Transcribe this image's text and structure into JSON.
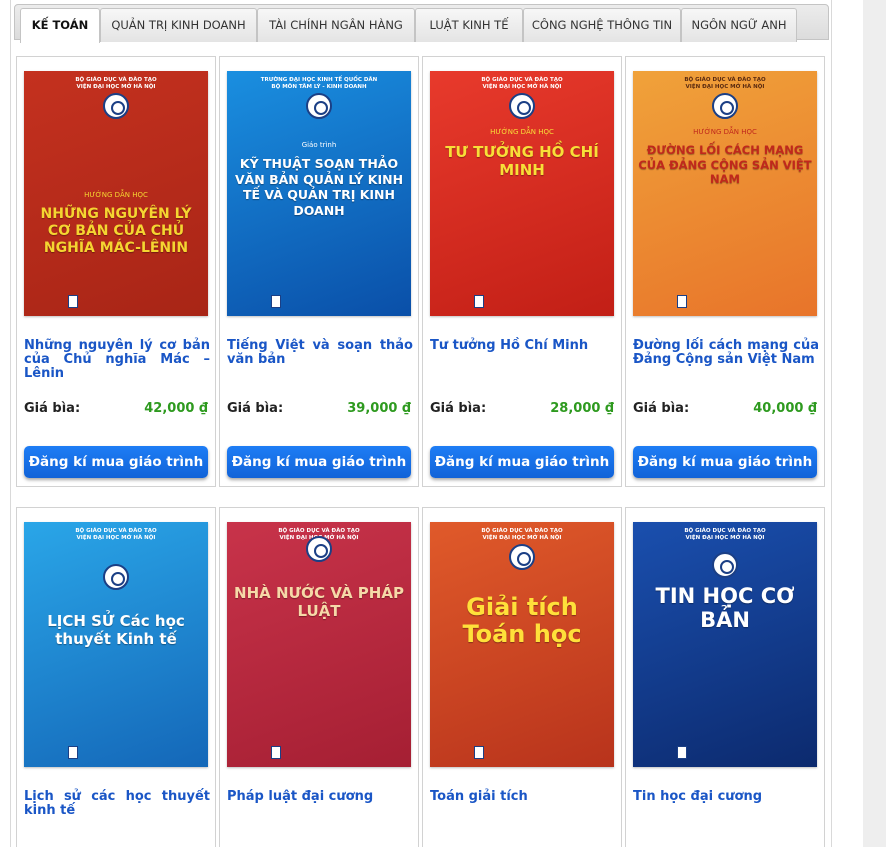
{
  "tabs": [
    {
      "label": "KẾ TOÁN",
      "active": true
    },
    {
      "label": "QUẢN TRỊ KINH DOANH",
      "active": false
    },
    {
      "label": "TÀI CHÍNH NGÂN HÀNG",
      "active": false
    },
    {
      "label": "LUẬT KINH TẾ",
      "active": false
    },
    {
      "label": "CÔNG NGHỆ THÔNG TIN",
      "active": false
    },
    {
      "label": "NGÔN NGỮ ANH",
      "active": false
    }
  ],
  "price_label": "Giá bìa:",
  "buy_label": "Đăng kí mua giáo trình",
  "books": [
    {
      "title": "Những nguyên lý cơ bản của Chủ nghĩa Mác – Lênin",
      "price": "42,000 ₫",
      "cover": {
        "publisher_top": "BỘ GIÁO DỤC VÀ ĐÀO TẠO\nVIỆN ĐẠI HỌC MỞ HÀ NỘI",
        "kicker": "HƯỚNG DẪN HỌC",
        "title": "NHỮNG NGUYÊN LÝ CƠ BẢN CỦA CHỦ NGHĨA MÁC-LÊNIN",
        "colors": [
          "#c4311f",
          "#a82516"
        ],
        "text_color": "#f5d531"
      }
    },
    {
      "title": "Tiếng Việt và soạn thảo văn bản",
      "price": "39,000 ₫",
      "cover": {
        "publisher_top": "TRƯỜNG ĐẠI HỌC KINH TẾ QUỐC DÂN\nBỘ MÔN TÂM LÝ - KINH DOANH",
        "kicker": "Giáo trình",
        "title": "KỸ THUẬT SOẠN THẢO VĂN BẢN QUẢN LÝ KINH TẾ VÀ QUẢN TRỊ KINH DOANH",
        "colors": [
          "#1a8fe0",
          "#0a4fa8"
        ],
        "text_color": "#ffffff"
      }
    },
    {
      "title": "Tư tưởng Hồ Chí Minh",
      "price": "28,000 ₫",
      "cover": {
        "publisher_top": "BỘ GIÁO DỤC VÀ ĐÀO TẠO\nVIỆN ĐẠI HỌC MỞ HÀ NỘI",
        "kicker": "HƯỚNG DẪN HỌC",
        "title": "TƯ TƯỞNG HỒ CHÍ MINH",
        "colors": [
          "#e83a2c",
          "#c21f16"
        ],
        "text_color": "#f8df38"
      }
    },
    {
      "title": "Đường lối cách mạng của Đảng Cộng sản Việt Nam",
      "price": "40,000 ₫",
      "cover": {
        "publisher_top": "BỘ GIÁO DỤC VÀ ĐÀO TẠO\nVIỆN ĐẠI HỌC MỞ HÀ NỘI",
        "kicker": "HƯỚNG DẪN HỌC",
        "title": "ĐƯỜNG LỐI CÁCH MẠNG CỦA ĐẢNG CỘNG SẢN VIỆT NAM",
        "colors": [
          "#f0a23a",
          "#e8742a"
        ],
        "text_color": "#c0281c"
      }
    },
    {
      "title": "Lịch sử các học thuyết kinh tế",
      "price": "",
      "cover": {
        "publisher_top": "BỘ GIÁO DỤC VÀ ĐÀO TẠO\nVIỆN ĐẠI HỌC MỞ HÀ NỘI",
        "kicker": "",
        "title": "LỊCH SỬ Các học thuyết Kinh tế",
        "colors": [
          "#2aa6e8",
          "#1467b8"
        ],
        "text_color": "#ffffff"
      }
    },
    {
      "title": "Pháp luật đại cương",
      "price": "",
      "cover": {
        "publisher_top": "BỘ GIÁO DỤC VÀ ĐÀO TẠO\nVIỆN ĐẠI HỌC MỞ HÀ NỘI",
        "kicker": "",
        "title": "NHÀ NƯỚC VÀ PHÁP LUẬT",
        "colors": [
          "#c8334a",
          "#a51f33"
        ],
        "text_color": "#f6d9a8"
      }
    },
    {
      "title": "Toán giải tích",
      "price": "",
      "cover": {
        "publisher_top": "BỘ GIÁO DỤC VÀ ĐÀO TẠO\nVIỆN ĐẠI HỌC MỞ HÀ NỘI",
        "kicker": "",
        "title": "Giải tích Toán học",
        "colors": [
          "#e05a2a",
          "#b8331c"
        ],
        "text_color": "#ffe03a"
      }
    },
    {
      "title": "Tin học đại cương",
      "price": "",
      "cover": {
        "publisher_top": "BỘ GIÁO DỤC VÀ ĐÀO TẠO\nVIỆN ĐẠI HỌC MỞ HÀ NỘI",
        "kicker": "",
        "title": "TIN HỌC CƠ BẢN",
        "colors": [
          "#1a4fae",
          "#0c2a6e"
        ],
        "text_color": "#ffffff"
      }
    }
  ]
}
